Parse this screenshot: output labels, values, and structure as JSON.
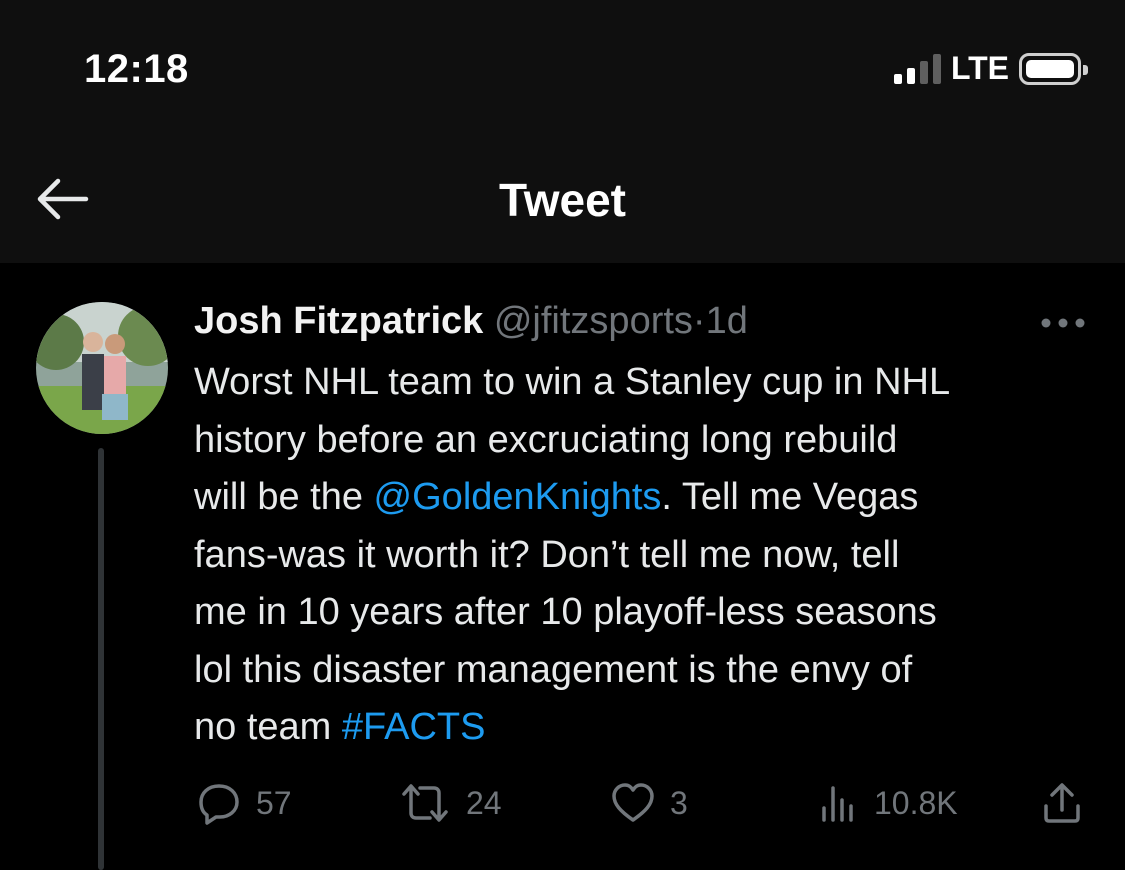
{
  "status_bar": {
    "time": "12:18",
    "network": "LTE",
    "signal_icon": "signal-bars-icon",
    "battery_icon": "battery-icon"
  },
  "nav": {
    "title": "Tweet",
    "back_icon": "back-arrow-icon"
  },
  "tweet": {
    "author_name": "Josh Fitzpatrick",
    "handle": "@jfitzsports",
    "separator": "·",
    "time_ago": "1d",
    "body": {
      "line1": "Worst NHL team to win a Stanley cup in NHL",
      "line2": "history before an excruciating long rebuild",
      "line3_pre": "will be the ",
      "mention": "@GoldenKnights",
      "line3_post": ". Tell me Vegas",
      "line4": "fans-was it worth it? Don’t tell me now, tell",
      "line5": "me in 10 years after 10 playoff-less seasons",
      "line6": "lol this disaster management is the envy of",
      "line7_pre": "no team ",
      "hashtag": "#FACTS"
    },
    "actions": {
      "replies": "57",
      "retweets": "24",
      "likes": "3",
      "views": "10.8K"
    }
  },
  "colors": {
    "accent": "#1d9bf0",
    "muted": "#71767b",
    "text": "#e7e9ea",
    "background": "#000000",
    "header": "#0f0f0f"
  }
}
